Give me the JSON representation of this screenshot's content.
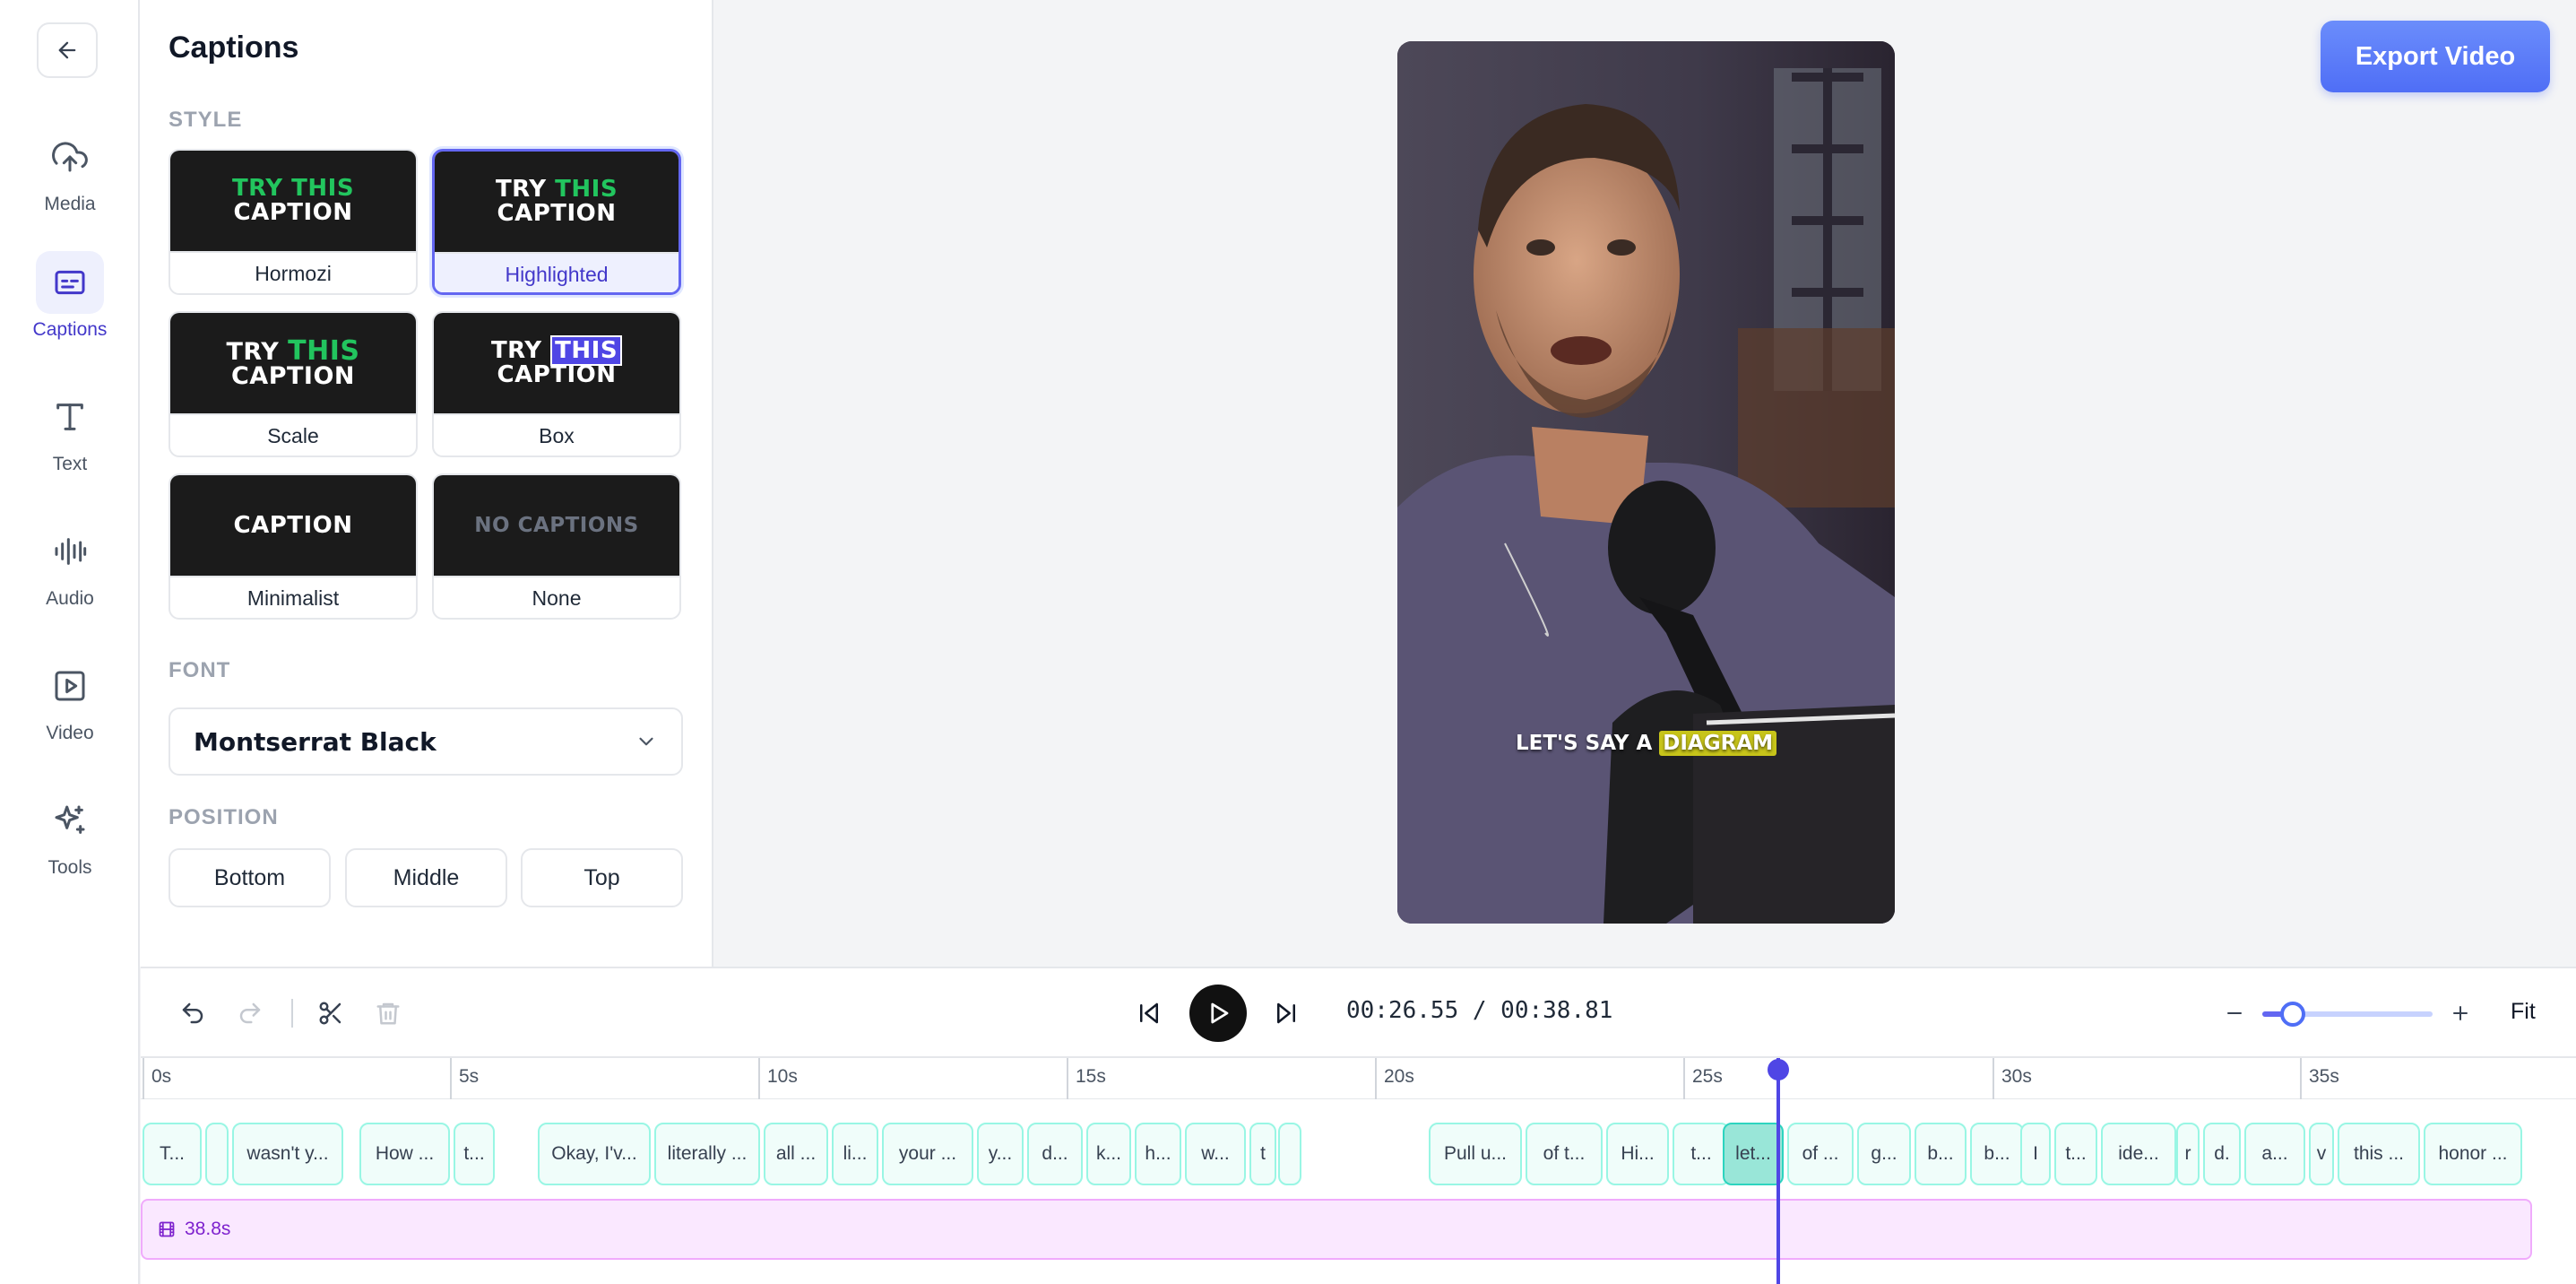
{
  "sidebar": {
    "items": [
      {
        "label": "Media",
        "icon": "upload-cloud-icon"
      },
      {
        "label": "Captions",
        "icon": "captions-icon",
        "active": true
      },
      {
        "label": "Text",
        "icon": "text-icon"
      },
      {
        "label": "Audio",
        "icon": "audio-wave-icon"
      },
      {
        "label": "Video",
        "icon": "video-icon"
      },
      {
        "label": "Tools",
        "icon": "sparkles-icon"
      }
    ]
  },
  "panel": {
    "title": "Captions",
    "style_label": "STYLE",
    "styles": [
      {
        "name": "Hormozi",
        "line1a": "TRY ",
        "line1b": "THIS",
        "line2": "CAPTION"
      },
      {
        "name": "Highlighted",
        "line1a": "TRY ",
        "line1b": "THIS",
        "line2": "CAPTION",
        "selected": true
      },
      {
        "name": "Scale",
        "line1a": "TRY ",
        "line1b": "THIS",
        "line2": "CAPTION"
      },
      {
        "name": "Box",
        "line1a": "TRY ",
        "line1b": "THIS",
        "line2": "CAPTION"
      },
      {
        "name": "Minimalist",
        "text": "CAPTION"
      },
      {
        "name": "None",
        "text": "NO CAPTIONS"
      }
    ],
    "font_label": "FONT",
    "font_value": "Montserrat Black",
    "position_label": "POSITION",
    "positions": [
      "Bottom",
      "Middle",
      "Top"
    ]
  },
  "preview": {
    "caption_plain": "LET'S SAY A ",
    "caption_highlight": "DIAGRAM",
    "highlight_color": "#c7c41a"
  },
  "export_label": "Export Video",
  "toolbar": {
    "timecode": "00:26.55 / 00:38.81",
    "fit_label": "Fit",
    "zoom_level": 0.18
  },
  "timeline": {
    "ticks": [
      "0s",
      "5s",
      "10s",
      "15s",
      "20s",
      "25s",
      "30s",
      "35s"
    ],
    "chips": [
      "T...",
      "",
      "wasn't y...",
      "How ...",
      "t...",
      "Okay, I'v...",
      "literally ...",
      "all ...",
      "li...",
      "your ...",
      "y...",
      "d...",
      "k...",
      "h...",
      "w...",
      "t",
      "",
      "Pull u...",
      "of t...",
      "Hi...",
      "t...",
      "let...",
      "of ...",
      "g...",
      "b...",
      "b...",
      "I",
      "t...",
      "ide...",
      "r",
      "d.",
      "a...",
      "v",
      "this ...",
      "honor ..."
    ],
    "active_chip": "let...",
    "track_label": "38.8s"
  }
}
